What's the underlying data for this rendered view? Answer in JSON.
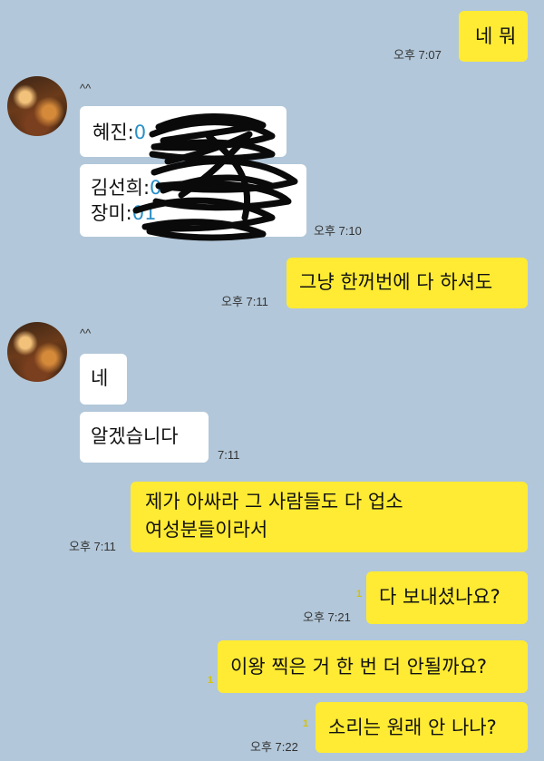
{
  "messages": [
    {
      "id": "m1",
      "text": "네 뭐",
      "time": "오후 7:07"
    },
    {
      "id": "m2",
      "sender": "^^",
      "contact_lines": [
        {
          "label": "혜진:",
          "value": "0"
        },
        {
          "label": "김선희:",
          "value": "0"
        },
        {
          "label": "장미:",
          "value": "01"
        }
      ],
      "time": "오후 7:10"
    },
    {
      "id": "m3",
      "text": "그냥 한꺼번에 다 하셔도",
      "time": "오후 7:11"
    },
    {
      "id": "m4",
      "sender": "^^",
      "text": "네"
    },
    {
      "id": "m5",
      "text": "알겠습니다",
      "time": "7:11"
    },
    {
      "id": "m6",
      "lines": [
        "제가 아싸라 그 사람들도 다 업소",
        "여성분들이라서"
      ],
      "time": "오후 7:11"
    },
    {
      "id": "m7",
      "text": "다 보내셨나요?",
      "time": "오후 7:21",
      "unread": "1"
    },
    {
      "id": "m8",
      "text": "이왕 찍은 거 한 번 더 안될까요?",
      "unread": "1"
    },
    {
      "id": "m9",
      "text": "소리는 원래 안 나나?",
      "time": "오후 7:22",
      "unread": "1"
    }
  ],
  "colors": {
    "background": "#b2c7d9",
    "outgoing": "#ffeb33",
    "incoming": "#ffffff",
    "link": "#2a8fc7",
    "unread": "#d6c200"
  },
  "icons": {
    "avatar": "restaurant-photo-avatar",
    "redaction": "black-scribble"
  }
}
